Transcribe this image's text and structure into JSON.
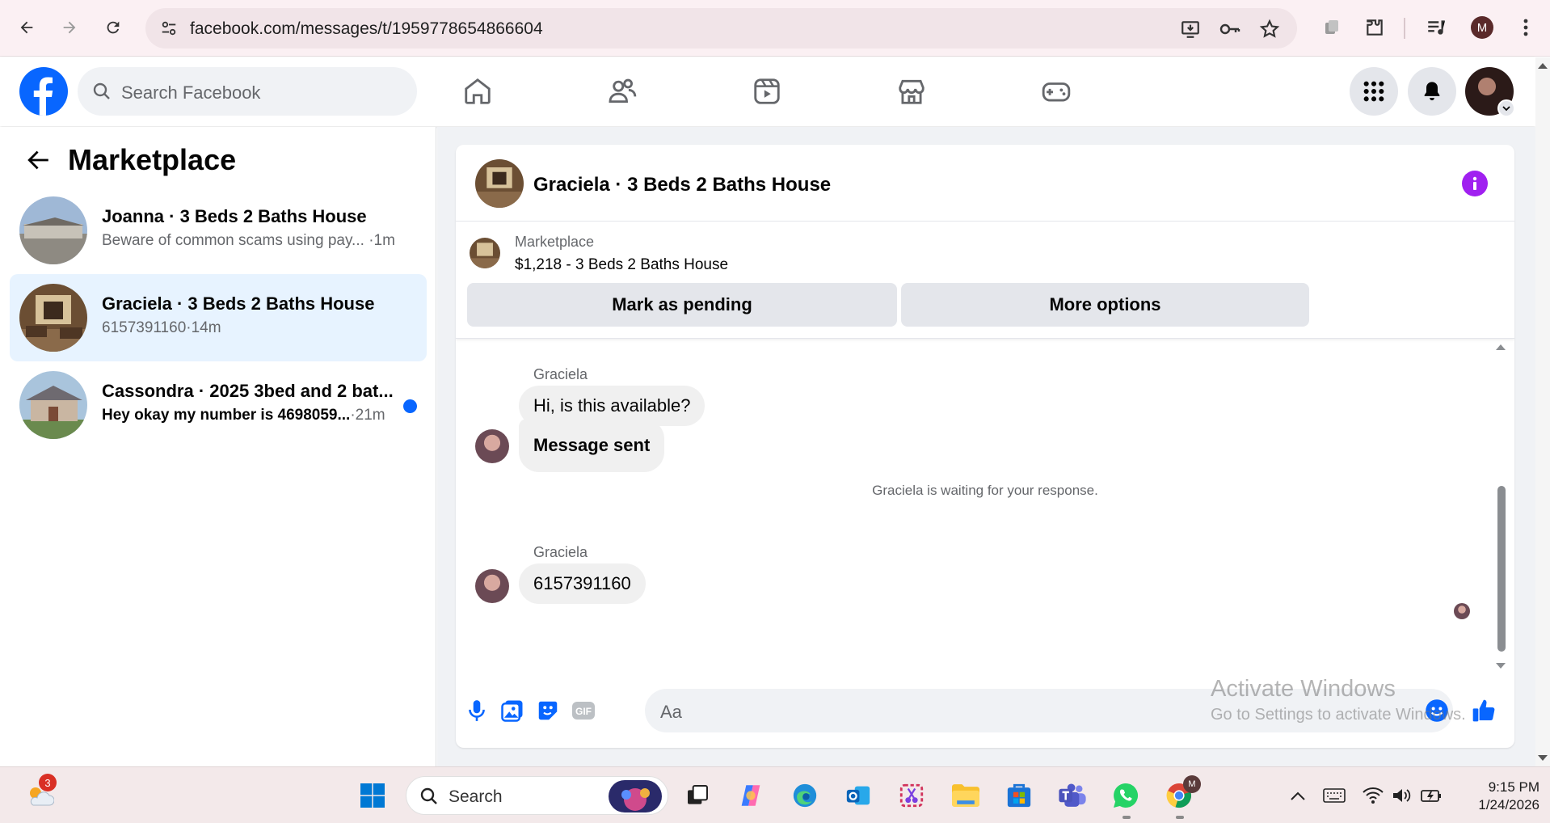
{
  "browser": {
    "url": "facebook.com/messages/t/1959778654866604",
    "profile_initial": "M"
  },
  "fb_header": {
    "search_placeholder": "Search Facebook"
  },
  "left_panel": {
    "title": "Marketplace",
    "conversations": [
      {
        "name": "Joanna · 3 Beds 2 Baths House",
        "preview": "Beware of common scams using pay...",
        "time": "·1m",
        "active": false,
        "unread": false
      },
      {
        "name": "Graciela · 3 Beds 2 Baths House",
        "preview": "6157391160",
        "time": "·14m",
        "active": true,
        "unread": false
      },
      {
        "name": "Cassondra · 2025 3bed and 2 bat...",
        "preview": "Hey okay my number is 4698059...",
        "time": "·21m",
        "active": false,
        "unread": true
      }
    ]
  },
  "chat": {
    "title": "Graciela · 3 Beds 2 Baths House",
    "listing": {
      "label": "Marketplace",
      "price_title": "$1,218 - 3 Beds 2 Baths House",
      "mark_pending": "Mark as pending",
      "more_options": "More options"
    },
    "messages": [
      {
        "sender": "Graciela",
        "text": "Hi, is this available?"
      },
      {
        "text": "Message sent"
      }
    ],
    "system_note": "Graciela is waiting for your response.",
    "messages2": [
      {
        "sender": "Graciela",
        "text": "6157391160"
      }
    ],
    "composer_placeholder": "Aa",
    "composer_icons": [
      "microphone-icon",
      "photo-icon",
      "sticker-icon",
      "gif-icon",
      "emoji-icon",
      "thumbs-up-icon"
    ]
  },
  "watermark": {
    "line1": "Activate Windows",
    "line2": "Go to Settings to activate Windows."
  },
  "taskbar": {
    "search_placeholder": "Search",
    "weather_badge": "3",
    "time": "9:15 PM",
    "date": "1/24/2026"
  },
  "colors": {
    "fb_blue": "#0866ff",
    "active_conv": "#e7f3ff",
    "info_purple": "#a020f0"
  }
}
